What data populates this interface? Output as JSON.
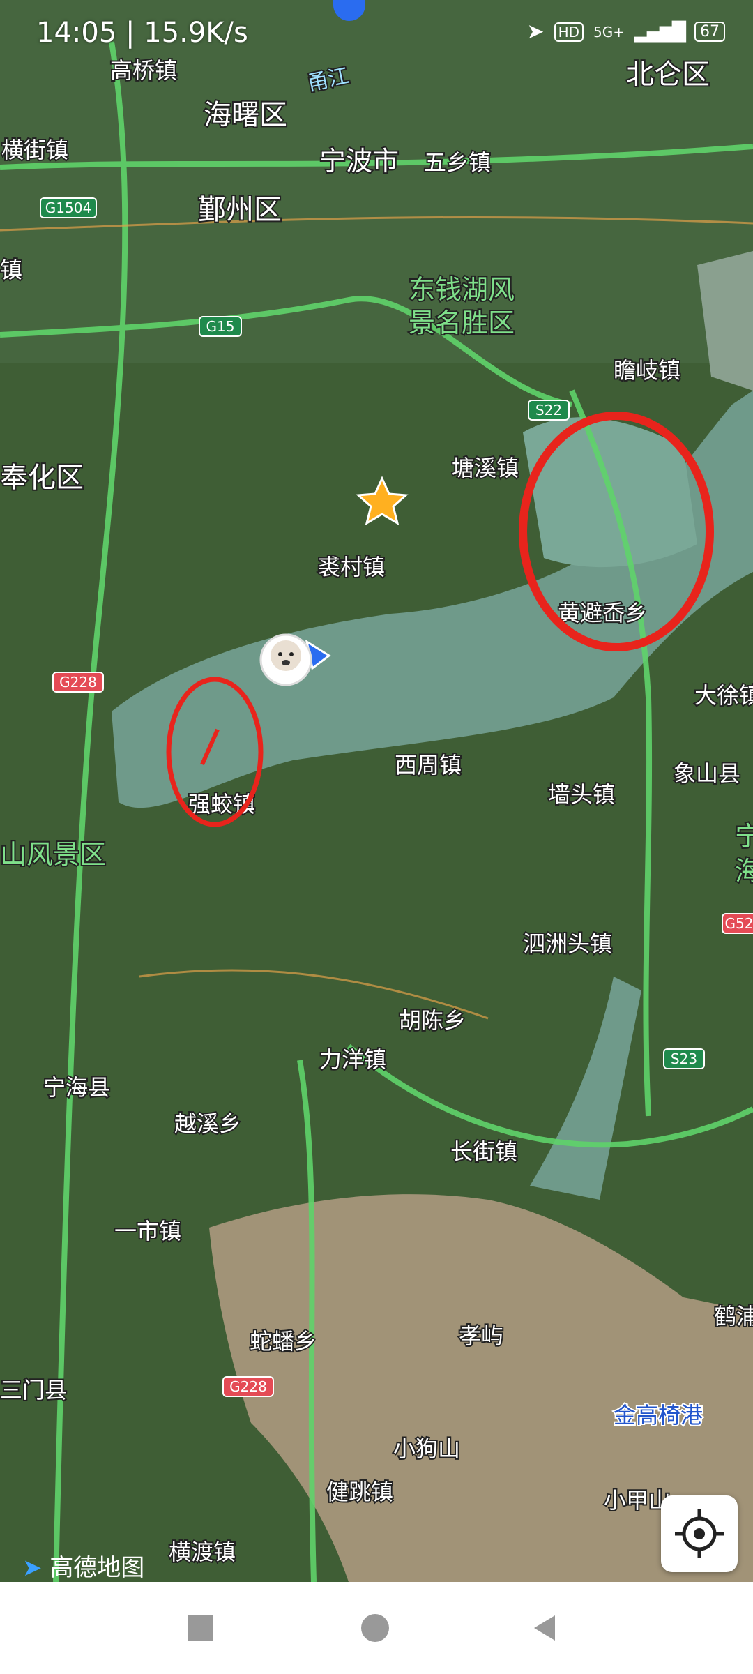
{
  "status_bar": {
    "time": "14:05",
    "speed": "15.9K/s",
    "network": "5G+",
    "hd": "HD",
    "battery": "67"
  },
  "map": {
    "roads": {
      "g1504": "G1504",
      "g15": "G15",
      "s22": "S22",
      "g228a": "G228",
      "g228b": "G228",
      "s23": "S23",
      "g52": "G52"
    },
    "places": {
      "gaoqiao": "高桥镇",
      "haishu": "海曙区",
      "yongjiang": "甬江",
      "beilun": "北仑区",
      "hengjie": "横街镇",
      "ningbo": "宁波市",
      "wuxiang": "五乡镇",
      "yinzhou": "鄞州区",
      "zhen_left": "镇",
      "dongqian": "东钱湖风",
      "dongqian2": "景名胜区",
      "zhanqi": "瞻岐镇",
      "fenghua": "奉化区",
      "tangxi": "塘溪镇",
      "qiucun": "裘村镇",
      "huangbi": "黄避岙乡",
      "daxu": "大徐镇",
      "xiangshan": "象山县",
      "qiangjiao": "强蛟镇",
      "xizhou": "西周镇",
      "qiangtou": "墙头镇",
      "shanfengjing": "山风景区",
      "sizhoutou": "泗洲头镇",
      "huchen": "胡陈乡",
      "liyang": "力洋镇",
      "ninghai": "宁海县",
      "yuexi": "越溪乡",
      "changjie": "长街镇",
      "yishi": "一市镇",
      "hepu": "鹤浦",
      "shepan": "蛇蟠乡",
      "xiaoyu": "孝屿",
      "sanmen": "三门县",
      "jingao": "金高椅港",
      "xiaogoushan": "小狗山",
      "jiantiao": "健跳镇",
      "xiaojiashan": "小甲山",
      "hengdu": "横渡镇",
      "ning_edge": "宁",
      "hai_edge": "海"
    },
    "logo": "高德地图",
    "colors": {
      "water": "#6f9a8a",
      "land": "#3f5e35",
      "road": "#5fd36a",
      "circle": "#e8241c"
    }
  },
  "nav": {
    "square": "square-icon",
    "home": "circle-icon",
    "back": "back-icon"
  }
}
